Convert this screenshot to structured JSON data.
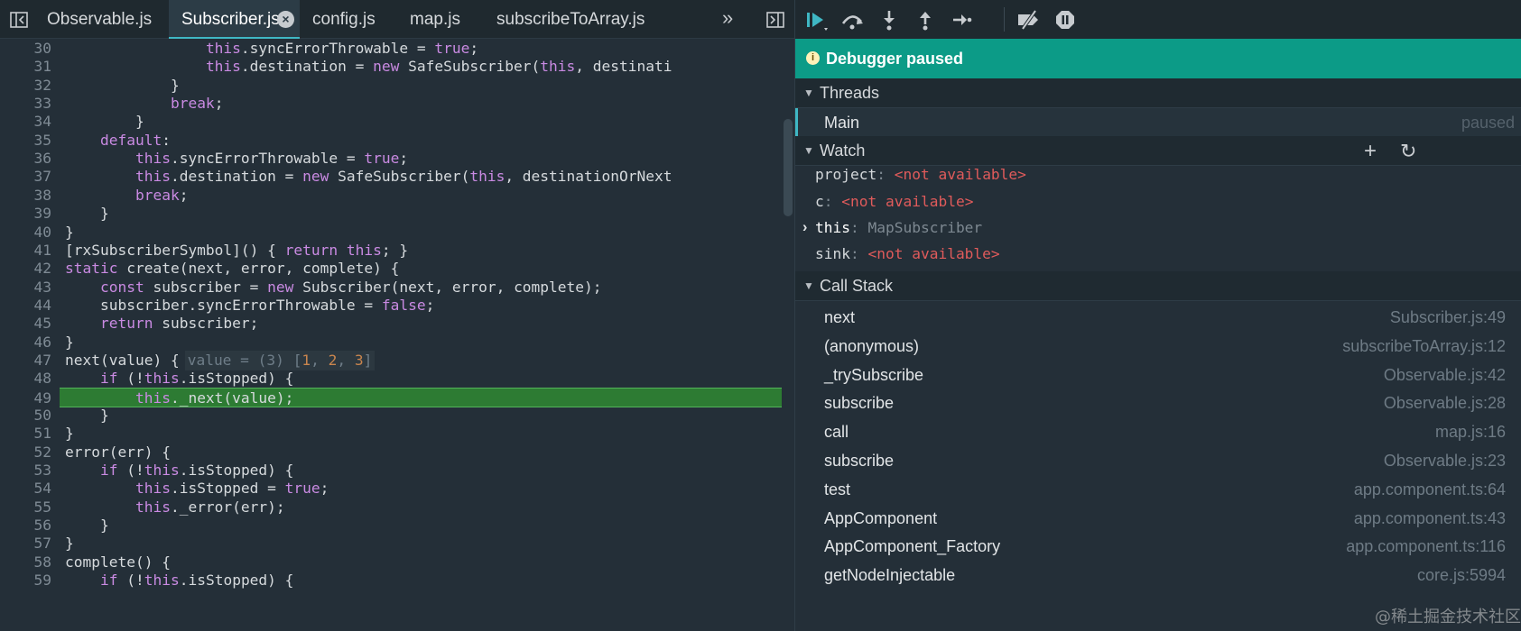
{
  "editor": {
    "tabs": [
      {
        "label": "Observable.js",
        "active": false
      },
      {
        "label": "Subscriber.js",
        "active": true
      },
      {
        "label": "config.js",
        "active": false
      },
      {
        "label": "map.js",
        "active": false
      },
      {
        "label": "subscribeToArray.js",
        "active": false
      }
    ],
    "more_glyph": "»",
    "close_glyph": "×",
    "paused_line": 49,
    "lines": [
      {
        "n": "30",
        "text": "                    this.syncErrorThrowable = true;"
      },
      {
        "n": "31",
        "text": "                    this.destination = new SafeSubscriber(this, destinati"
      },
      {
        "n": "32",
        "text": "                }"
      },
      {
        "n": "33",
        "text": "                break;"
      },
      {
        "n": "34",
        "text": "            }"
      },
      {
        "n": "35",
        "text": "        default:"
      },
      {
        "n": "36",
        "text": "            this.syncErrorThrowable = true;"
      },
      {
        "n": "37",
        "text": "            this.destination = new SafeSubscriber(this, destinationOrNext"
      },
      {
        "n": "38",
        "text": "            break;"
      },
      {
        "n": "39",
        "text": "        }"
      },
      {
        "n": "40",
        "text": "    }"
      },
      {
        "n": "41",
        "text": "    [rxSubscriberSymbol]() { return this; }"
      },
      {
        "n": "42",
        "text": "    static create(next, error, complete) {"
      },
      {
        "n": "43",
        "text": "        const subscriber = new Subscriber(next, error, complete);"
      },
      {
        "n": "44",
        "text": "        subscriber.syncErrorThrowable = false;"
      },
      {
        "n": "45",
        "text": "        return subscriber;"
      },
      {
        "n": "46",
        "text": "    }"
      },
      {
        "n": "47",
        "text": "    next(value) {"
      },
      {
        "n": "48",
        "text": "        if (!this.isStopped) {"
      },
      {
        "n": "49",
        "text": "            this._next(value);"
      },
      {
        "n": "50",
        "text": "        }"
      },
      {
        "n": "51",
        "text": "    }"
      },
      {
        "n": "52",
        "text": "    error(err) {"
      },
      {
        "n": "53",
        "text": "        if (!this.isStopped) {"
      },
      {
        "n": "54",
        "text": "            this.isStopped = true;"
      },
      {
        "n": "55",
        "text": "            this._error(err);"
      },
      {
        "n": "56",
        "text": "        }"
      },
      {
        "n": "57",
        "text": "    }"
      },
      {
        "n": "58",
        "text": "    complete() {"
      },
      {
        "n": "59",
        "text": "        if (!this.isStopped) {"
      }
    ],
    "inline_value": {
      "line": "47",
      "prefix": "value = (3) [",
      "values": [
        "1",
        "2",
        "3"
      ],
      "suffix": "]"
    }
  },
  "debugger": {
    "toolbar": {
      "buttons": [
        {
          "name": "resume-icon",
          "title": "Resume"
        },
        {
          "name": "step-over-icon",
          "title": "Step over"
        },
        {
          "name": "step-in-icon",
          "title": "Step in"
        },
        {
          "name": "step-out-icon",
          "title": "Step out"
        },
        {
          "name": "step-icon",
          "title": "Step"
        },
        {
          "name": "deactivate-breakpoints-icon",
          "title": "Deactivate breakpoints"
        },
        {
          "name": "pause-on-exceptions-icon",
          "title": "Pause on exceptions"
        }
      ]
    },
    "banner": {
      "info_glyph": "i",
      "text": "Debugger paused"
    },
    "threads": {
      "title": "Threads",
      "items": [
        {
          "label": "Main",
          "status": "paused"
        }
      ]
    },
    "watch": {
      "title": "Watch",
      "add_glyph": "+",
      "refresh_glyph": "↻",
      "items": [
        {
          "name": "project",
          "value": "<not available>",
          "expandable": false
        },
        {
          "name": "c",
          "value": "<not available>",
          "expandable": false
        },
        {
          "name": "this",
          "value": "MapSubscriber",
          "expandable": true
        },
        {
          "name": "sink",
          "value": "<not available>",
          "expandable": false
        }
      ],
      "separator": ": "
    },
    "call_stack": {
      "title": "Call Stack",
      "frames": [
        {
          "fn": "next",
          "loc": "Subscriber.js:49"
        },
        {
          "fn": "(anonymous)",
          "loc": "subscribeToArray.js:12"
        },
        {
          "fn": "_trySubscribe",
          "loc": "Observable.js:42"
        },
        {
          "fn": "subscribe",
          "loc": "Observable.js:28"
        },
        {
          "fn": "call",
          "loc": "map.js:16"
        },
        {
          "fn": "subscribe",
          "loc": "Observable.js:23"
        },
        {
          "fn": "test",
          "loc": "app.component.ts:64"
        },
        {
          "fn": "AppComponent",
          "loc": "app.component.ts:43"
        },
        {
          "fn": "AppComponent_Factory",
          "loc": "app.component.ts:116"
        },
        {
          "fn": "getNodeInjectable",
          "loc": "core.js:5994"
        }
      ]
    }
  },
  "watermark": "@稀土掘金技术社区",
  "colors": {
    "accent": "#3fb7c4",
    "paused_banner": "#0c9b87",
    "paused_line": "#2d7b33",
    "keyword": "#c98ae2",
    "not_available": "#e05b5b"
  }
}
